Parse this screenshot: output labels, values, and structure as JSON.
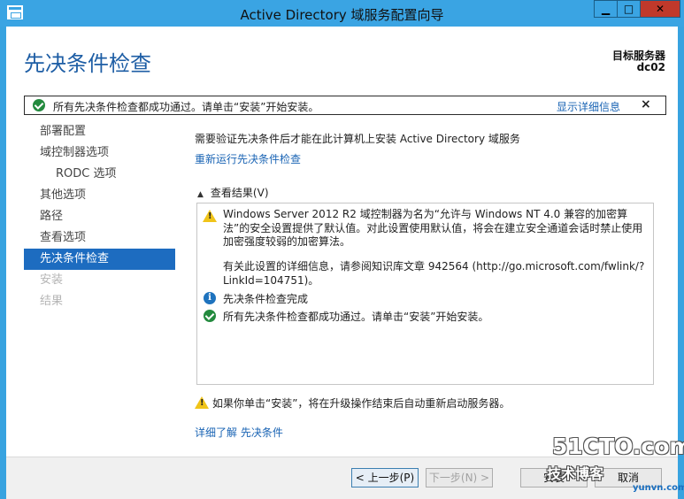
{
  "window": {
    "title": "Active Directory 域服务配置向导",
    "minimize_glyph": "▁",
    "maximize_glyph": "□",
    "close_glyph": "✕"
  },
  "header": {
    "page_title": "先决条件检查",
    "target_server_label": "目标服务器",
    "target_server_name": "dc02"
  },
  "notice": {
    "text": "所有先决条件检查都成功通过。请单击“安装”开始安装。",
    "details_link": "显示详细信息",
    "close_glyph": "×"
  },
  "nav": {
    "items": [
      {
        "label": "部署配置",
        "state": "normal"
      },
      {
        "label": "域控制器选项",
        "state": "normal"
      },
      {
        "label": "RODC 选项",
        "state": "sub"
      },
      {
        "label": "其他选项",
        "state": "normal"
      },
      {
        "label": "路径",
        "state": "normal"
      },
      {
        "label": "查看选项",
        "state": "normal"
      },
      {
        "label": "先决条件检查",
        "state": "active"
      },
      {
        "label": "安装",
        "state": "disabled"
      },
      {
        "label": "结果",
        "state": "disabled"
      }
    ]
  },
  "main": {
    "description": "需要验证先决条件后才能在此计算机上安装 Active Directory 域服务",
    "rerun_link": "重新运行先决条件检查",
    "results_toggle": "查看结果(V)",
    "results": {
      "warning_text": "Windows Server 2012 R2 域控制器为名为“允许与 Windows NT 4.0 兼容的加密算法”的安全设置提供了默认值。对此设置使用默认值，将会在建立安全通道会话时禁止使用加密强度较弱的加密算法。",
      "kb_text": "有关此设置的详细信息，请参阅知识库文章 942564 (http://go.microsoft.com/fwlink/?LinkId=104751)。",
      "info_text": "先决条件检查完成",
      "success_text": "所有先决条件检查都成功通过。请单击“安装”开始安装。"
    },
    "restart_warning": "如果你单击“安装”，将在升级操作结束后自动重新启动服务器。",
    "more_link": "详细了解 先决条件"
  },
  "footer": {
    "prev_label": "< 上一步(P)",
    "next_label": "下一步(N) >",
    "install_label": "安装",
    "cancel_label": "取消"
  },
  "watermark": {
    "line1": "51CTO.com",
    "line2": "技术博客",
    "line3": "yunvn.com"
  },
  "colors": {
    "title_bar": "#3aa4e3",
    "heading_blue": "#1e5ea5",
    "nav_active": "#1d6cc0",
    "link_blue": "#1a64b4",
    "success_green": "#238a3e",
    "warning_yellow": "#f0c419",
    "close_red": "#c0392b"
  }
}
